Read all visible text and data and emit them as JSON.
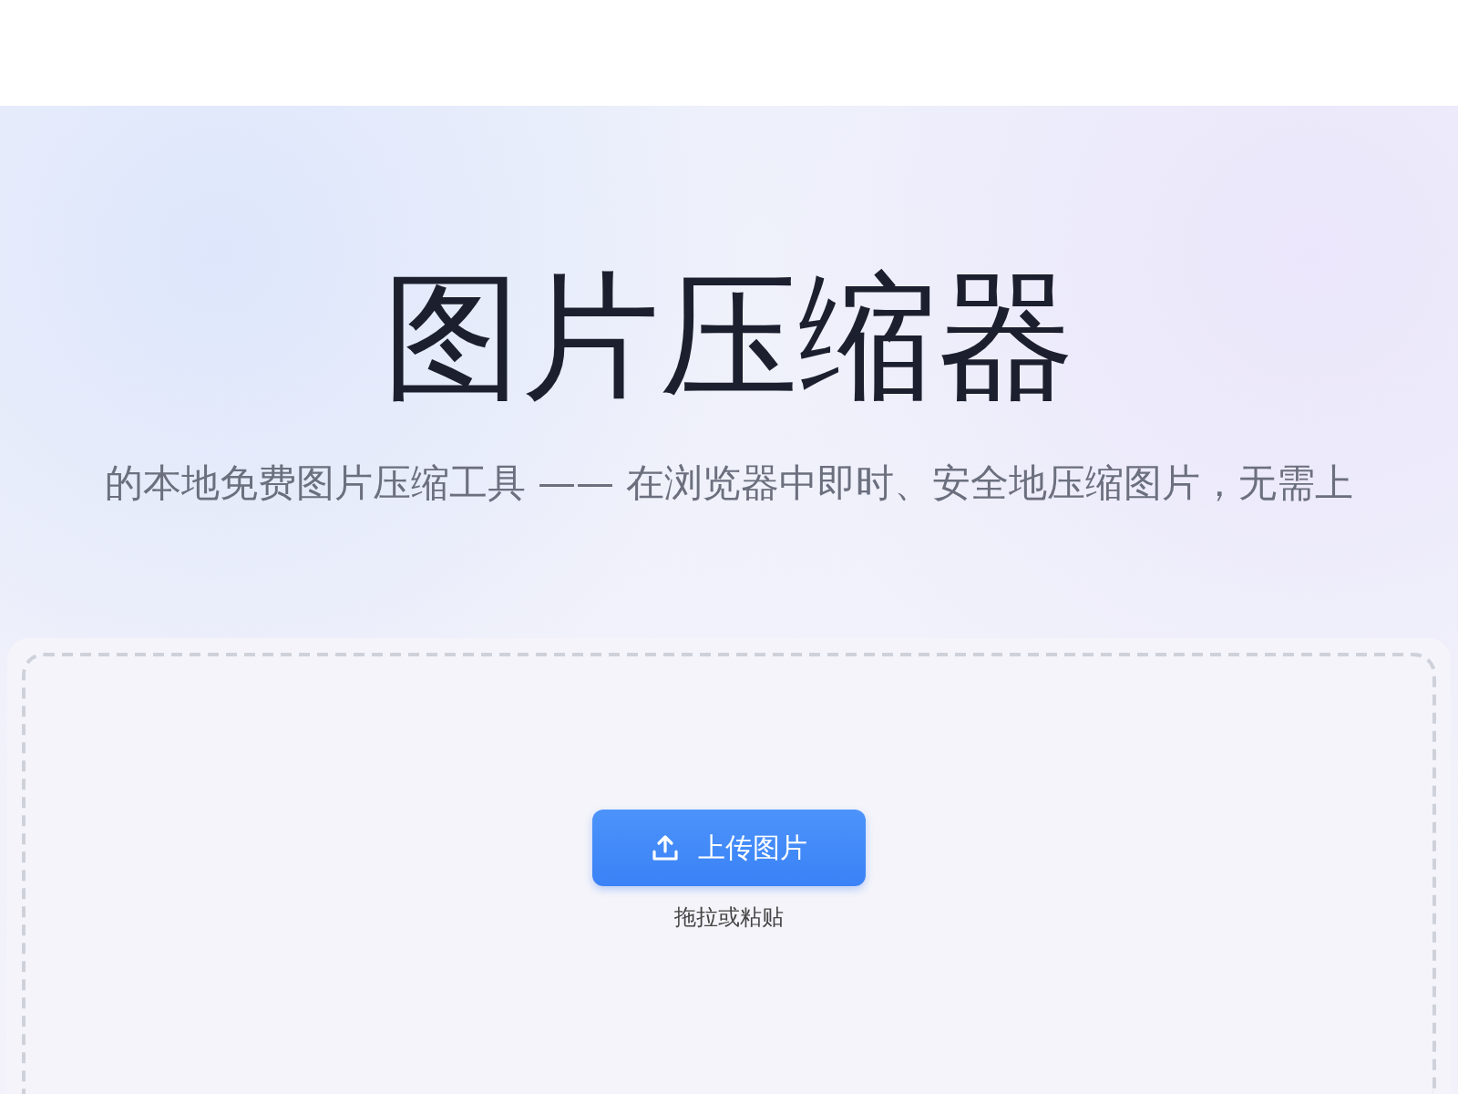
{
  "hero": {
    "title": "图片压缩器",
    "subtitle": "的本地免费图片压缩工具 —— 在浏览器中即时、安全地压缩图片，无需上"
  },
  "dropzone": {
    "button": "上传图片",
    "hint": "拖拉或粘贴"
  }
}
